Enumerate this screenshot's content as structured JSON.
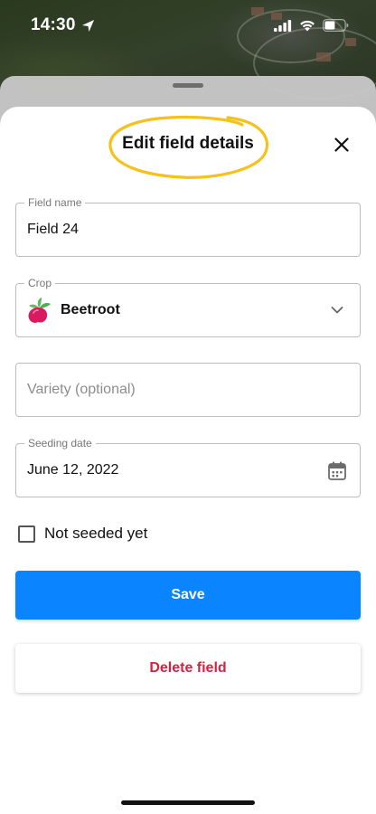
{
  "status_bar": {
    "time": "14:30",
    "icons": [
      "location-arrow-icon",
      "cellular-signal-icon",
      "wifi-icon",
      "battery-icon"
    ]
  },
  "sheet": {
    "title": "Edit field details",
    "close_icon": "close-icon",
    "annotation_color": "#f5c11a"
  },
  "form": {
    "field_name": {
      "label": "Field name",
      "value": "Field 24"
    },
    "crop": {
      "label": "Crop",
      "value": "Beetroot",
      "icon": "beetroot-icon",
      "chevron_icon": "chevron-down-icon"
    },
    "variety": {
      "placeholder": "Variety (optional)"
    },
    "seeding_date": {
      "label": "Seeding date",
      "value": "June 12, 2022",
      "icon": "calendar-icon"
    },
    "not_seeded": {
      "label": "Not seeded yet",
      "checked": false
    }
  },
  "actions": {
    "save_label": "Save",
    "delete_label": "Delete field"
  },
  "colors": {
    "primary": "#0a84ff",
    "danger": "#d6223f",
    "border": "#bdbdbd"
  }
}
